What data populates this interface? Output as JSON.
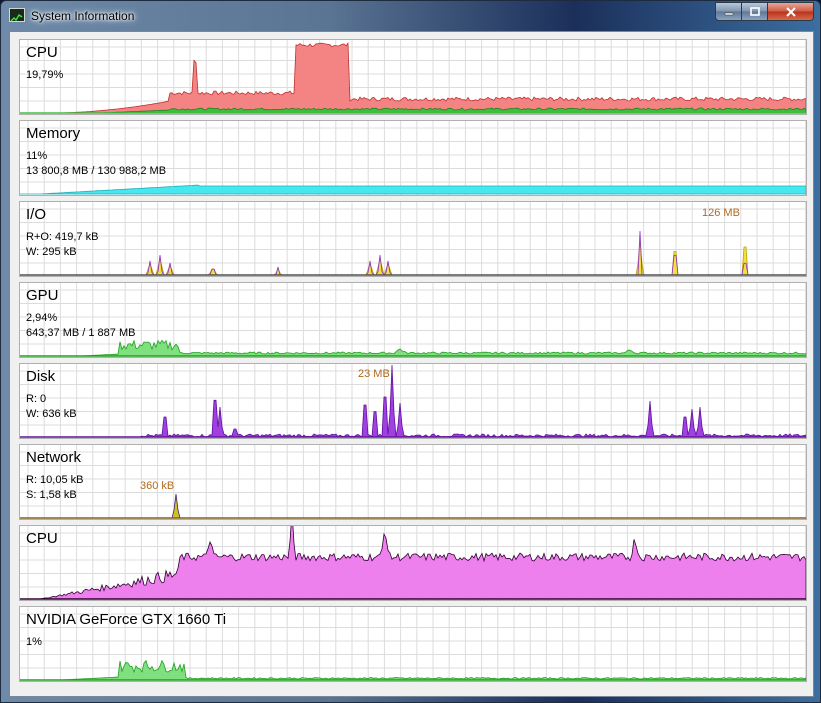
{
  "window": {
    "title": "System Information",
    "icon": "chart-icon",
    "controls": {
      "minimize": "minimize-icon",
      "maximize": "maximize-icon",
      "close": "close-icon"
    }
  },
  "panels": [
    {
      "title": "CPU",
      "lines": [
        "19,79%"
      ],
      "peak_label": ""
    },
    {
      "title": "Memory",
      "lines": [
        "11%",
        "13 800,8 MB / 130 988,2 MB"
      ],
      "peak_label": ""
    },
    {
      "title": "I/O",
      "lines": [
        "R+O: 419,7 kB",
        "W: 295 kB"
      ],
      "peak_label": "126 MB"
    },
    {
      "title": "GPU",
      "lines": [
        "2,94%",
        "643,37 MB / 1 887 MB"
      ],
      "peak_label": ""
    },
    {
      "title": "Disk",
      "lines": [
        "R: 0",
        "W: 636 kB"
      ],
      "peak_label": "23 MB"
    },
    {
      "title": "Network",
      "lines": [
        "R: 10,05 kB",
        "S: 1,58 kB"
      ],
      "peak_label": "360 kB"
    },
    {
      "title": "CPU",
      "lines": [
        ""
      ],
      "peak_label": ""
    },
    {
      "title": "NVIDIA GeForce GTX 1660 Ti",
      "lines": [
        "1%"
      ],
      "peak_label": ""
    }
  ],
  "colors": {
    "cpu_fill": "#f48484",
    "cpu_kernel": "#3cc03c",
    "memory_fill": "#44e8ee",
    "io_read": "#f0e040",
    "io_write": "#9030d0",
    "gpu_fill": "#7ee07e",
    "disk_fill": "#a040e0",
    "network_fill": "#d0c020",
    "cpu2_fill": "#ee80ee",
    "grid": "#dcdcdc"
  }
}
